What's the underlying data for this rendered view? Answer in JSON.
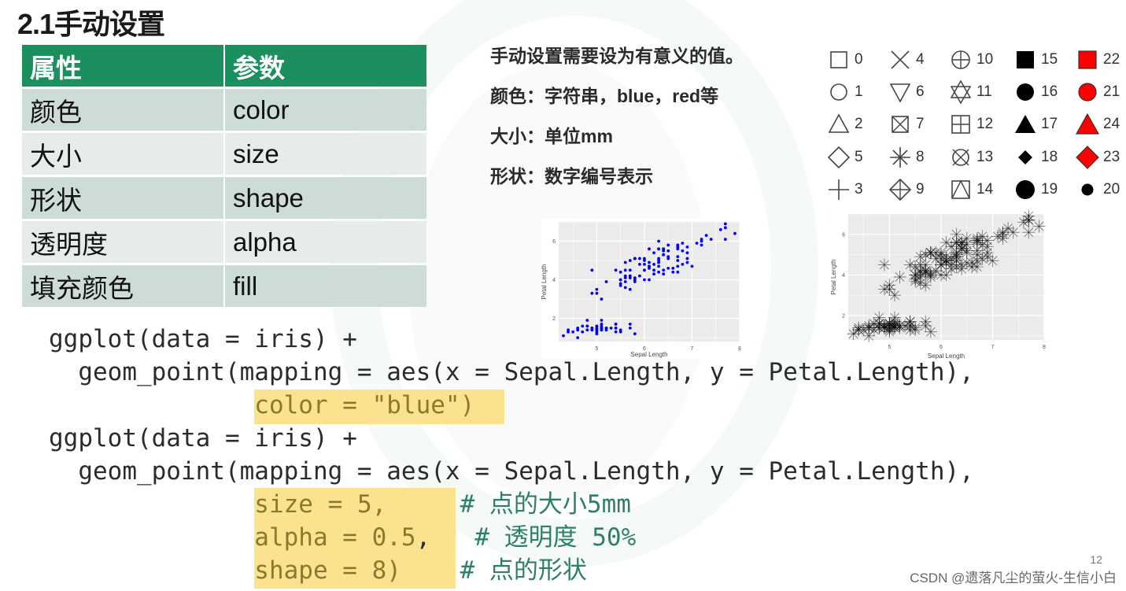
{
  "slide": {
    "title": "2.1手动设置",
    "page_number": "12",
    "credit": "CSDN @遗落凡尘的萤火-生信小白"
  },
  "table": {
    "headers": [
      "属性",
      "参数"
    ],
    "rows": [
      [
        "颜色",
        "color"
      ],
      [
        "大小",
        "size"
      ],
      [
        "形状",
        "shape"
      ],
      [
        "透明度",
        "alpha"
      ],
      [
        "填充颜色",
        "fill"
      ]
    ],
    "header_color": "#1c8f5f"
  },
  "notes": [
    "手动设置需要设为有意义的值。",
    "颜色：字符串，blue，red等",
    "大小：单位mm",
    "形状：数字编号表示"
  ],
  "shape_legend": {
    "columns": [
      [
        {
          "code": "0",
          "shape": "square-open"
        },
        {
          "code": "1",
          "shape": "circle-open"
        },
        {
          "code": "2",
          "shape": "triangle-open"
        },
        {
          "code": "5",
          "shape": "diamond-open"
        },
        {
          "code": "3",
          "shape": "plus"
        }
      ],
      [
        {
          "code": "4",
          "shape": "cross"
        },
        {
          "code": "6",
          "shape": "triangle-down-open"
        },
        {
          "code": "7",
          "shape": "square-cross"
        },
        {
          "code": "8",
          "shape": "asterisk"
        },
        {
          "code": "9",
          "shape": "diamond-plus"
        }
      ],
      [
        {
          "code": "10",
          "shape": "circle-plus"
        },
        {
          "code": "11",
          "shape": "star-of-david"
        },
        {
          "code": "12",
          "shape": "square-plus"
        },
        {
          "code": "13",
          "shape": "circle-cross"
        },
        {
          "code": "14",
          "shape": "square-triangle"
        }
      ],
      [
        {
          "code": "15",
          "shape": "square-filled"
        },
        {
          "code": "16",
          "shape": "circle-filled"
        },
        {
          "code": "17",
          "shape": "triangle-filled"
        },
        {
          "code": "18",
          "shape": "diamond-filled-small"
        },
        {
          "code": "19",
          "shape": "circle-filled-large"
        }
      ],
      [
        {
          "code": "22",
          "shape": "square-fill-red"
        },
        {
          "code": "21",
          "shape": "circle-fill-red"
        },
        {
          "code": "24",
          "shape": "triangle-fill-red"
        },
        {
          "code": "23",
          "shape": "diamond-fill-red"
        },
        {
          "code": "20",
          "shape": "circle-filled-small"
        }
      ]
    ],
    "fill_color": "#ff0000"
  },
  "code": {
    "block1": {
      "line1": "ggplot(data = iris) +",
      "line2": "  geom_point(mapping = aes(x = Sepal.Length, y = Petal.Length),",
      "line3_highlight": "color = \"blue\")"
    },
    "block2": {
      "line1": "ggplot(data = iris) +",
      "line2": "  geom_point(mapping = aes(x = Sepal.Length, y = Petal.Length),",
      "line3_highlight": "size = 5,",
      "line3_comment": "# 点的大小5mm",
      "line4_highlight": "alpha = 0.5",
      "line4_tail": ",",
      "line4_comment": "# 透明度 50%",
      "line5_highlight": "shape = 8)",
      "line5_comment": "# 点的形状"
    }
  },
  "chart_data": [
    {
      "type": "scatter",
      "title": "",
      "xlabel": "Sepal Length",
      "ylabel": "Petal Length",
      "xlim": [
        4.2,
        8.0
      ],
      "ylim": [
        0.8,
        7.0
      ],
      "xticks": [
        "5",
        "6",
        "7",
        "8"
      ],
      "yticks": [
        "2",
        "4",
        "6"
      ],
      "grid": true,
      "point_color": "#0000ff",
      "point_shape": 16,
      "alpha": 1.0,
      "x": [
        5.1,
        4.9,
        4.7,
        4.6,
        5.0,
        5.4,
        4.6,
        5.0,
        4.4,
        4.9,
        5.4,
        4.8,
        4.8,
        4.3,
        5.8,
        5.7,
        5.4,
        5.1,
        5.7,
        5.1,
        5.4,
        5.1,
        4.6,
        5.1,
        4.8,
        5.0,
        5.0,
        5.2,
        5.2,
        4.7,
        4.8,
        5.4,
        5.2,
        5.5,
        4.9,
        5.0,
        5.5,
        4.9,
        4.4,
        5.1,
        5.0,
        4.5,
        4.4,
        5.0,
        5.1,
        4.8,
        5.1,
        4.6,
        5.3,
        5.0,
        7.0,
        6.4,
        6.9,
        5.5,
        6.5,
        5.7,
        6.3,
        4.9,
        6.6,
        5.2,
        5.0,
        5.9,
        6.0,
        6.1,
        5.6,
        6.7,
        5.6,
        5.8,
        6.2,
        5.6,
        5.9,
        6.1,
        6.3,
        6.1,
        6.4,
        6.6,
        6.8,
        6.7,
        6.0,
        5.7,
        5.5,
        5.5,
        5.8,
        6.0,
        5.4,
        6.0,
        6.7,
        6.3,
        5.6,
        5.5,
        5.5,
        6.1,
        5.8,
        5.0,
        5.6,
        5.7,
        5.7,
        6.2,
        5.1,
        5.7,
        6.3,
        5.8,
        7.1,
        6.3,
        6.5,
        7.6,
        4.9,
        7.3,
        6.7,
        7.2,
        6.5,
        6.4,
        6.8,
        5.7,
        5.8,
        6.4,
        6.5,
        7.7,
        7.7,
        6.0,
        6.9,
        5.6,
        7.7,
        6.3,
        6.7,
        7.2,
        6.2,
        6.1,
        6.4,
        7.2,
        7.4,
        7.9,
        6.4,
        6.3,
        6.1,
        7.7,
        6.3,
        6.4,
        6.0,
        6.9,
        6.7,
        6.9,
        5.8,
        6.8,
        6.7,
        6.7,
        6.3,
        6.5,
        6.2,
        5.9
      ],
      "y": [
        1.4,
        1.4,
        1.3,
        1.5,
        1.4,
        1.7,
        1.4,
        1.5,
        1.4,
        1.5,
        1.5,
        1.6,
        1.4,
        1.1,
        1.2,
        1.5,
        1.3,
        1.4,
        1.7,
        1.5,
        1.7,
        1.5,
        1.0,
        1.7,
        1.9,
        1.6,
        1.6,
        1.5,
        1.4,
        1.6,
        1.6,
        1.5,
        1.5,
        1.4,
        1.5,
        1.2,
        1.3,
        1.4,
        1.3,
        1.5,
        1.3,
        1.3,
        1.3,
        1.6,
        1.9,
        1.4,
        1.6,
        1.4,
        1.5,
        1.4,
        4.7,
        4.5,
        4.9,
        4.0,
        4.6,
        4.5,
        4.7,
        3.3,
        4.6,
        3.9,
        3.5,
        4.2,
        4.0,
        4.7,
        3.6,
        4.4,
        4.5,
        4.1,
        4.5,
        3.9,
        4.8,
        4.0,
        4.9,
        4.7,
        4.3,
        4.4,
        4.8,
        5.0,
        4.5,
        3.5,
        3.8,
        3.7,
        3.9,
        5.1,
        4.5,
        4.5,
        4.7,
        4.4,
        4.1,
        4.0,
        4.4,
        4.6,
        4.0,
        3.3,
        4.2,
        4.2,
        4.2,
        4.3,
        3.0,
        4.1,
        6.0,
        5.1,
        5.9,
        5.6,
        5.8,
        6.6,
        4.5,
        6.3,
        5.8,
        6.1,
        5.1,
        5.3,
        5.5,
        5.0,
        5.1,
        5.3,
        5.5,
        6.7,
        6.9,
        5.0,
        5.7,
        4.9,
        6.7,
        4.9,
        5.7,
        6.0,
        4.8,
        4.9,
        5.6,
        5.8,
        6.1,
        6.4,
        5.6,
        5.1,
        5.6,
        6.1,
        5.6,
        5.5,
        4.8,
        5.4,
        5.6,
        5.1,
        5.1,
        5.9,
        5.7,
        5.2,
        5.0,
        5.2,
        5.4,
        5.1
      ]
    },
    {
      "type": "scatter",
      "title": "",
      "xlabel": "Sepal Length",
      "ylabel": "Petal Length",
      "xlim": [
        4.2,
        8.0
      ],
      "ylim": [
        0.8,
        7.0
      ],
      "xticks": [
        "5",
        "6",
        "7",
        "8"
      ],
      "yticks": [
        "2",
        "4",
        "6"
      ],
      "grid": true,
      "point_color": "#000000",
      "point_shape": 8,
      "point_size_mm": 5,
      "alpha": 0.5,
      "same_data_as_previous": true
    }
  ]
}
